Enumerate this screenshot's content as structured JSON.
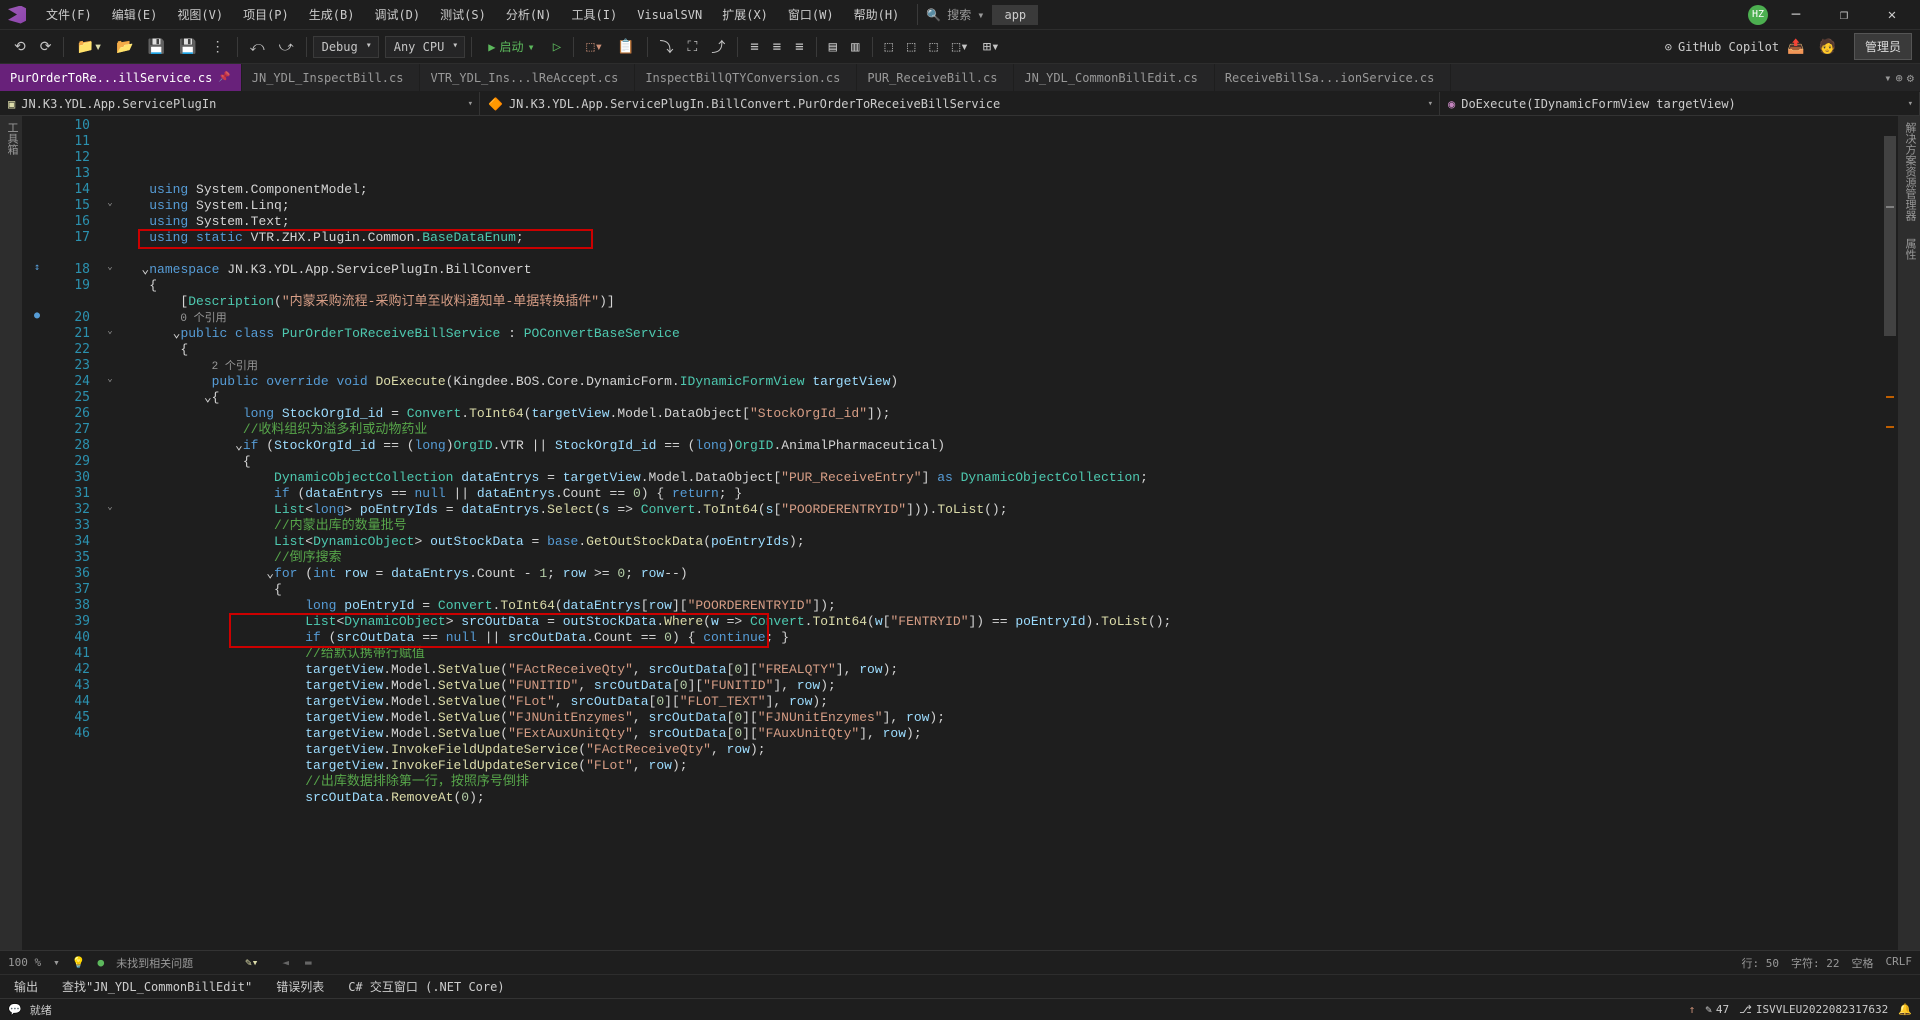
{
  "menu": {
    "file": "文件(F)",
    "edit": "编辑(E)",
    "view": "视图(V)",
    "project": "项目(P)",
    "build": "生成(B)",
    "debug": "调试(D)",
    "test": "测试(S)",
    "analyze": "分析(N)",
    "tools": "工具(I)",
    "visualsvn": "VisualSVN",
    "extensions": "扩展(X)",
    "window": "窗口(W)",
    "help": "帮助(H)"
  },
  "search": {
    "label": "搜索",
    "shortcut": "▾"
  },
  "app_label": "app",
  "avatar": "HZ",
  "toolbar": {
    "config": "Debug",
    "platform": "Any CPU",
    "start": "启动",
    "copilot": "GitHub Copilot",
    "admin": "管理员"
  },
  "tabs": [
    {
      "label": "PurOrderToRe...illService.cs",
      "active": true,
      "pinned": true
    },
    {
      "label": "JN_YDL_InspectBill.cs",
      "active": false
    },
    {
      "label": "VTR_YDL_Ins...lReAccept.cs",
      "active": false
    },
    {
      "label": "InspectBillQTYConversion.cs",
      "active": false
    },
    {
      "label": "PUR_ReceiveBill.cs",
      "active": false
    },
    {
      "label": "JN_YDL_CommonBillEdit.cs",
      "active": false
    },
    {
      "label": "ReceiveBillSa...ionService.cs",
      "active": false
    }
  ],
  "nav": {
    "namespace": "JN.K3.YDL.App.ServicePlugIn",
    "class": "JN.K3.YDL.App.ServicePlugIn.BillConvert.PurOrderToReceiveBillService",
    "method": "DoExecute(IDynamicFormView targetView)"
  },
  "left_tool": "工具箱",
  "right_tool1": "解决方案资源管理器",
  "right_tool2": "属性",
  "line_start": 10,
  "code_lines": [
    {
      "n": 10,
      "fold": "",
      "html": "    <span class='kw'>using</span> System.ComponentModel;"
    },
    {
      "n": 11,
      "fold": "",
      "html": "    <span class='kw'>using</span> System.Linq;"
    },
    {
      "n": 12,
      "fold": "",
      "html": "    <span class='kw'>using</span> System.Text;"
    },
    {
      "n": 13,
      "fold": "",
      "html": "    <span class='kw'>using static</span> VTR.ZHX.Plugin.Common.<span class='type'>BaseDataEnum</span>;"
    },
    {
      "n": 14,
      "fold": "",
      "html": ""
    },
    {
      "n": 15,
      "fold": "⌄",
      "html": "   ⌄<span class='kw'>namespace</span> JN.K3.YDL.App.ServicePlugIn.BillConvert"
    },
    {
      "n": 16,
      "fold": "",
      "html": "    {"
    },
    {
      "n": 17,
      "fold": "",
      "html": "        [<span class='type'>Description</span>(<span class='str'>\"内蒙采购流程-采购订单至收料通知单-单据转换插件\"</span>)]"
    },
    {
      "n": "",
      "fold": "",
      "html": "        <span class='ref'>0 个引用</span>"
    },
    {
      "n": 18,
      "fold": "⌄",
      "mark": "↕",
      "html": "       ⌄<span class='kw'>public class</span> <span class='type'>PurOrderToReceiveBillService</span> : <span class='type'>POConvertBaseService</span>"
    },
    {
      "n": 19,
      "fold": "",
      "html": "        {"
    },
    {
      "n": "",
      "fold": "",
      "html": "            <span class='ref'>2 个引用</span>"
    },
    {
      "n": 20,
      "fold": "",
      "mark": "●",
      "html": "            <span class='kw'>public override void</span> <span class='fn'>DoExecute</span>(Kingdee.BOS.Core.DynamicForm.<span class='type'>IDynamicFormView</span> <span class='var'>targetView</span>)"
    },
    {
      "n": 21,
      "fold": "⌄",
      "html": "           ⌄{"
    },
    {
      "n": 22,
      "fold": "",
      "html": "                <span class='kw'>long</span> <span class='var'>StockOrgId_id</span> = <span class='type'>Convert</span>.<span class='fn'>ToInt64</span>(<span class='var'>targetView</span>.Model.DataObject[<span class='str'>\"StockOrgId_id\"</span>]);"
    },
    {
      "n": 23,
      "fold": "",
      "html": "                <span class='cmt'>//收料组织为溢多利或动物药业</span>"
    },
    {
      "n": 24,
      "fold": "⌄",
      "html": "               ⌄<span class='kw'>if</span> (<span class='var'>StockOrgId_id</span> == (<span class='kw'>long</span>)<span class='type'>OrgID</span>.VTR || <span class='var'>StockOrgId_id</span> == (<span class='kw'>long</span>)<span class='type'>OrgID</span>.AnimalPharmaceutical)"
    },
    {
      "n": 25,
      "fold": "",
      "html": "                {"
    },
    {
      "n": 26,
      "fold": "",
      "html": "                    <span class='type'>DynamicObjectCollection</span> <span class='var'>dataEntrys</span> = <span class='var'>targetView</span>.Model.DataObject[<span class='str'>\"PUR_ReceiveEntry\"</span>] <span class='kw'>as</span> <span class='type'>DynamicObjectCollection</span>;"
    },
    {
      "n": 27,
      "fold": "",
      "html": "                    <span class='kw'>if</span> (<span class='var'>dataEntrys</span> == <span class='kw'>null</span> || <span class='var'>dataEntrys</span>.Count == <span class='num'>0</span>) { <span class='kw'>return</span>; }"
    },
    {
      "n": 28,
      "fold": "",
      "html": "                    <span class='type'>List</span>&lt;<span class='kw'>long</span>&gt; <span class='var'>poEntryIds</span> = <span class='var'>dataEntrys</span>.<span class='fn'>Select</span>(<span class='var'>s</span> =&gt; <span class='type'>Convert</span>.<span class='fn'>ToInt64</span>(<span class='var'>s</span>[<span class='str'>\"POORDERENTRYID\"</span>])).<span class='fn'>ToList</span>();"
    },
    {
      "n": 29,
      "fold": "",
      "html": "                    <span class='cmt'>//内蒙出库的数量批号</span>"
    },
    {
      "n": 30,
      "fold": "",
      "html": "                    <span class='type'>List</span>&lt;<span class='type'>DynamicObject</span>&gt; <span class='var'>outStockData</span> = <span class='kw'>base</span>.<span class='fn'>GetOutStockData</span>(<span class='var'>poEntryIds</span>);"
    },
    {
      "n": 31,
      "fold": "",
      "html": "                    <span class='cmt'>//倒序搜索</span>"
    },
    {
      "n": 32,
      "fold": "⌄",
      "html": "                   ⌄<span class='kw'>for</span> (<span class='kw'>int</span> <span class='var'>row</span> = <span class='var'>dataEntrys</span>.Count - <span class='num'>1</span>; <span class='var'>row</span> &gt;= <span class='num'>0</span>; <span class='var'>row</span>--)"
    },
    {
      "n": 33,
      "fold": "",
      "html": "                    {"
    },
    {
      "n": 34,
      "fold": "",
      "html": "                        <span class='kw'>long</span> <span class='var'>poEntryId</span> = <span class='type'>Convert</span>.<span class='fn'>ToInt64</span>(<span class='var'>dataEntrys</span>[<span class='var'>row</span>][<span class='str'>\"POORDERENTRYID\"</span>]);"
    },
    {
      "n": 35,
      "fold": "",
      "html": "                        <span class='type'>List</span>&lt;<span class='type'>DynamicObject</span>&gt; <span class='var'>srcOutData</span> = <span class='var'>outStockData</span>.<span class='fn'>Where</span>(<span class='var'>w</span> =&gt; <span class='type'>Convert</span>.<span class='fn'>ToInt64</span>(<span class='var'>w</span>[<span class='str'>\"FENTRYID\"</span>]) == <span class='var'>poEntryId</span>).<span class='fn'>ToList</span>();"
    },
    {
      "n": 36,
      "fold": "",
      "html": "                        <span class='kw'>if</span> (<span class='var'>srcOutData</span> == <span class='kw'>null</span> || <span class='var'>srcOutData</span>.Count == <span class='num'>0</span>) { <span class='kw'>continue</span>; }"
    },
    {
      "n": 37,
      "fold": "",
      "html": "                        <span class='cmt'>//给默认携带行赋值</span>"
    },
    {
      "n": 38,
      "fold": "",
      "html": "                        <span class='var'>targetView</span>.Model.<span class='fn'>SetValue</span>(<span class='str'>\"FActReceiveQty\"</span>, <span class='var'>srcOutData</span>[<span class='num'>0</span>][<span class='str'>\"FREALQTY\"</span>], <span class='var'>row</span>);"
    },
    {
      "n": 39,
      "fold": "",
      "html": "                        <span class='var'>targetView</span>.Model.<span class='fn'>SetValue</span>(<span class='str'>\"FUNITID\"</span>, <span class='var'>srcOutData</span>[<span class='num'>0</span>][<span class='str'>\"FUNITID\"</span>], <span class='var'>row</span>);"
    },
    {
      "n": 40,
      "fold": "",
      "html": "                        <span class='var'>targetView</span>.Model.<span class='fn'>SetValue</span>(<span class='str'>\"FLot\"</span>, <span class='var'>srcOutData</span>[<span class='num'>0</span>][<span class='str'>\"FLOT_TEXT\"</span>], <span class='var'>row</span>);"
    },
    {
      "n": 41,
      "fold": "",
      "html": "                        <span class='var'>targetView</span>.Model.<span class='fn'>SetValue</span>(<span class='str'>\"FJNUnitEnzymes\"</span>, <span class='var'>srcOutData</span>[<span class='num'>0</span>][<span class='str'>\"FJNUnitEnzymes\"</span>], <span class='var'>row</span>);"
    },
    {
      "n": 42,
      "fold": "",
      "html": "                        <span class='var'>targetView</span>.Model.<span class='fn'>SetValue</span>(<span class='str'>\"FExtAuxUnitQty\"</span>, <span class='var'>srcOutData</span>[<span class='num'>0</span>][<span class='str'>\"FAuxUnitQty\"</span>], <span class='var'>row</span>);"
    },
    {
      "n": 43,
      "fold": "",
      "html": "                        <span class='var'>targetView</span>.<span class='fn'>InvokeFieldUpdateService</span>(<span class='str'>\"FActReceiveQty\"</span>, <span class='var'>row</span>);"
    },
    {
      "n": 44,
      "fold": "",
      "html": "                        <span class='var'>targetView</span>.<span class='fn'>InvokeFieldUpdateService</span>(<span class='str'>\"FLot\"</span>, <span class='var'>row</span>);"
    },
    {
      "n": 45,
      "fold": "",
      "html": "                        <span class='cmt'>//出库数据排除第一行，按照序号倒排</span>"
    },
    {
      "n": 46,
      "fold": "",
      "html": "                        <span class='var'>srcOutData</span>.<span class='fn'>RemoveAt</span>(<span class='num'>0</span>);"
    }
  ],
  "status_info": {
    "zoom": "100 %",
    "issues": "未找到相关问题",
    "line": "行: 50",
    "col": "字符: 22",
    "spaces": "空格",
    "encoding": "CRLF"
  },
  "bottom_tabs": {
    "output": "输出",
    "find": "查找\"JN_YDL_CommonBillEdit\"",
    "errors": "错误列表",
    "interactive": "C# 交互窗口 (.NET Core)"
  },
  "status_bar": {
    "ready": "就绪",
    "changes": "47",
    "workspace": "ISVVLEU2022082317632",
    "source_control": "↑"
  }
}
